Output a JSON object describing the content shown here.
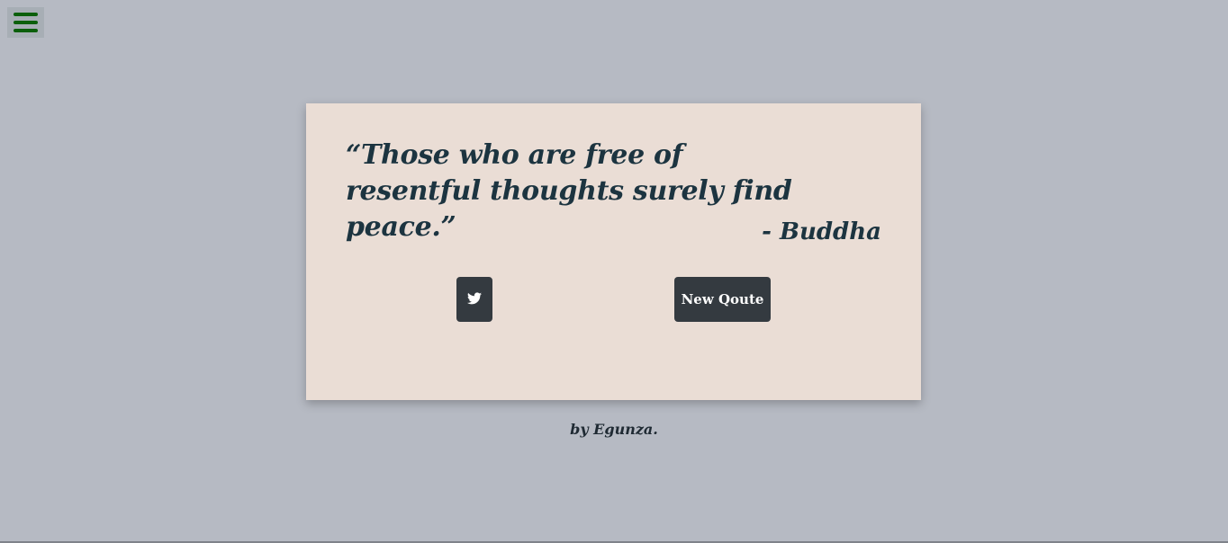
{
  "menu": {
    "icon": "hamburger-menu-icon",
    "icon_color": "#0b5f0b"
  },
  "quote": {
    "text": "“Those who are free of resentful thoughts surely find peace.”",
    "author": "- Buddha"
  },
  "actions": {
    "tweet_icon": "twitter-icon",
    "new_quote_label": "New Qoute"
  },
  "footer": {
    "credit": "by Egunza."
  },
  "colors": {
    "background": "#b6bac3",
    "card": "#eaddd5",
    "text": "#1c3440",
    "button": "#343a40"
  }
}
